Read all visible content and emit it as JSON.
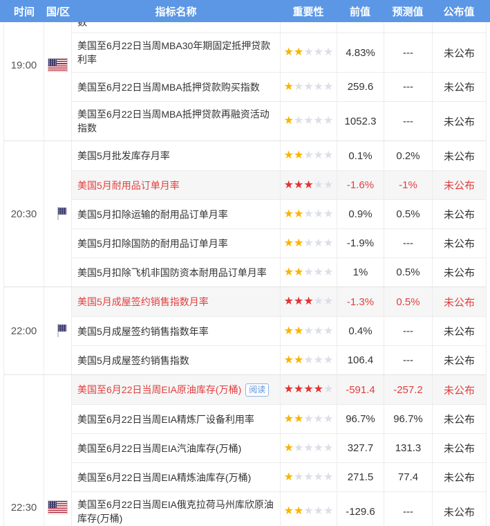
{
  "columns": [
    "时间",
    "国/区",
    "指标名称",
    "重要性",
    "前值",
    "预测值",
    "公布值"
  ],
  "colors": {
    "header_bg": "#5b97e5",
    "star_gold": "#f7b500",
    "star_red": "#e23333",
    "star_inactive": "#dcdfe8",
    "highlight_red": "#e23e3e",
    "badge_blue": "#5a8fdc"
  },
  "icons": {
    "flag": "us-flag-icon"
  },
  "groups": [
    {
      "time": "19:00",
      "country": "美国",
      "rows": [
        {
          "label": "数",
          "partial": true,
          "stars": 0,
          "star_color": "",
          "prev": "",
          "forecast": "",
          "published": "",
          "highlight": false,
          "badge": ""
        },
        {
          "label": "美国至6月22日当周MBA30年期固定抵押贷款利率",
          "partial": false,
          "stars": 2,
          "star_color": "gold",
          "prev": "4.83%",
          "forecast": "---",
          "published": "未公布",
          "highlight": false,
          "badge": ""
        },
        {
          "label": "美国至6月22日当周MBA抵押贷款购买指数",
          "partial": false,
          "stars": 1,
          "star_color": "gold",
          "prev": "259.6",
          "forecast": "---",
          "published": "未公布",
          "highlight": false,
          "badge": ""
        },
        {
          "label": "美国至6月22日当周MBA抵押贷款再融资活动指数",
          "partial": false,
          "stars": 1,
          "star_color": "gold",
          "prev": "1052.3",
          "forecast": "---",
          "published": "未公布",
          "highlight": false,
          "badge": ""
        }
      ]
    },
    {
      "time": "20:30",
      "country": "美国",
      "rows": [
        {
          "label": "美国5月批发库存月率",
          "partial": false,
          "stars": 2,
          "star_color": "gold",
          "prev": "0.1%",
          "forecast": "0.2%",
          "published": "未公布",
          "highlight": false,
          "badge": ""
        },
        {
          "label": "美国5月耐用品订单月率",
          "partial": false,
          "stars": 3,
          "star_color": "red",
          "prev": "-1.6%",
          "forecast": "-1%",
          "published": "未公布",
          "highlight": true,
          "badge": ""
        },
        {
          "label": "美国5月扣除运输的耐用品订单月率",
          "partial": false,
          "stars": 2,
          "star_color": "gold",
          "prev": "0.9%",
          "forecast": "0.5%",
          "published": "未公布",
          "highlight": false,
          "badge": ""
        },
        {
          "label": "美国5月扣除国防的耐用品订单月率",
          "partial": false,
          "stars": 2,
          "star_color": "gold",
          "prev": "-1.9%",
          "forecast": "---",
          "published": "未公布",
          "highlight": false,
          "badge": ""
        },
        {
          "label": "美国5月扣除飞机非国防资本耐用品订单月率",
          "partial": false,
          "stars": 2,
          "star_color": "gold",
          "prev": "1%",
          "forecast": "0.5%",
          "published": "未公布",
          "highlight": false,
          "badge": ""
        }
      ]
    },
    {
      "time": "22:00",
      "country": "美国",
      "rows": [
        {
          "label": "美国5月成屋签约销售指数月率",
          "partial": false,
          "stars": 3,
          "star_color": "red",
          "prev": "-1.3%",
          "forecast": "0.5%",
          "published": "未公布",
          "highlight": true,
          "badge": ""
        },
        {
          "label": "美国5月成屋签约销售指数年率",
          "partial": false,
          "stars": 2,
          "star_color": "gold",
          "prev": "0.4%",
          "forecast": "---",
          "published": "未公布",
          "highlight": false,
          "badge": ""
        },
        {
          "label": "美国5月成屋签约销售指数",
          "partial": false,
          "stars": 2,
          "star_color": "gold",
          "prev": "106.4",
          "forecast": "---",
          "published": "未公布",
          "highlight": false,
          "badge": ""
        }
      ]
    },
    {
      "time": "22:30",
      "country": "美国",
      "rows": [
        {
          "label": "美国至6月22日当周EIA原油库存(万桶)",
          "partial": false,
          "stars": 4,
          "star_color": "red",
          "prev": "-591.4",
          "forecast": "-257.2",
          "published": "未公布",
          "highlight": true,
          "badge": "阅读"
        },
        {
          "label": "美国至6月22日当周EIA精炼厂设备利用率",
          "partial": false,
          "stars": 2,
          "star_color": "gold",
          "prev": "96.7%",
          "forecast": "96.7%",
          "published": "未公布",
          "highlight": false,
          "badge": ""
        },
        {
          "label": "美国至6月22日当周EIA汽油库存(万桶)",
          "partial": false,
          "stars": 1,
          "star_color": "gold",
          "prev": "327.7",
          "forecast": "131.3",
          "published": "未公布",
          "highlight": false,
          "badge": ""
        },
        {
          "label": "美国至6月22日当周EIA精炼油库存(万桶)",
          "partial": false,
          "stars": 1,
          "star_color": "gold",
          "prev": "271.5",
          "forecast": "77.4",
          "published": "未公布",
          "highlight": false,
          "badge": ""
        },
        {
          "label": "美国至6月22日当周EIA俄克拉荷马州库欣原油库存(万桶)",
          "partial": false,
          "stars": 2,
          "star_color": "gold",
          "prev": "-129.6",
          "forecast": "---",
          "published": "未公布",
          "highlight": false,
          "badge": ""
        }
      ]
    }
  ]
}
